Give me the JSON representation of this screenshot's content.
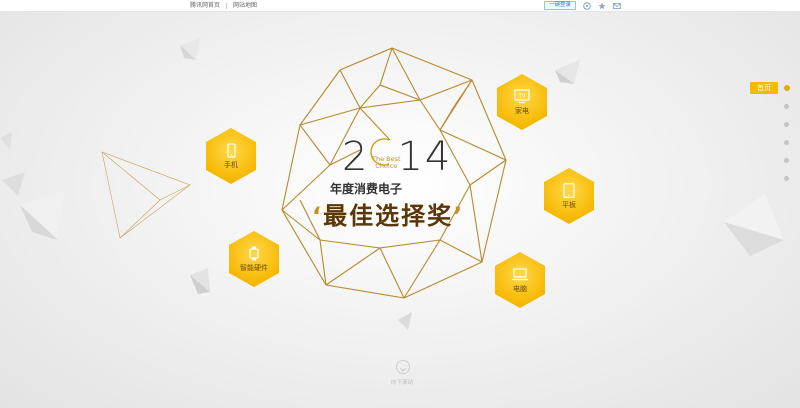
{
  "topbar": {
    "links": [
      "腾讯网首页",
      "网站地图"
    ],
    "login_label": "一键登录",
    "icons": [
      "qzone-icon",
      "star-icon",
      "mail-icon"
    ]
  },
  "title": {
    "year_a": "2",
    "year_b": "14",
    "best_choice_line1": "The Best",
    "best_choice_line2": "Choice",
    "subtitle": "年度消费电子",
    "main_title": "最佳选择奖",
    "quote_open": "‘",
    "quote_close": "’"
  },
  "categories": [
    {
      "label": "手机",
      "icon": "phone-icon"
    },
    {
      "label": "智能硬件",
      "icon": "smartwatch-icon"
    },
    {
      "label": "家电",
      "icon": "tv-icon",
      "icon_text": "TV"
    },
    {
      "label": "平板",
      "icon": "tablet-icon"
    },
    {
      "label": "电脑",
      "icon": "laptop-icon"
    }
  ],
  "side_nav": {
    "home_label": "首页",
    "dots_count": 6
  },
  "scroll": {
    "label": "向下滚动"
  },
  "colors": {
    "accent": "#f6b800",
    "gold_line": "#c9901c",
    "title_brown": "#5a3608"
  }
}
